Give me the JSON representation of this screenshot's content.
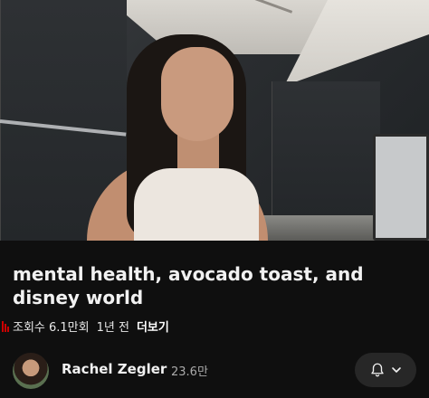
{
  "video": {
    "title": "mental health, avocado toast, and disney world",
    "views": "조회수 6.1만회",
    "age": "1년 전",
    "more_label": "더보기"
  },
  "channel": {
    "name": "Rachel Zegler",
    "subscribers": "23.6만"
  },
  "icons": {
    "views": "bar-chart-icon",
    "bell": "bell-icon",
    "chevron": "chevron-down-icon"
  },
  "colors": {
    "background": "#0f0f0f",
    "accent_red": "#cc0000",
    "subtext": "#aaaaaa",
    "button_bg": "#272727"
  }
}
